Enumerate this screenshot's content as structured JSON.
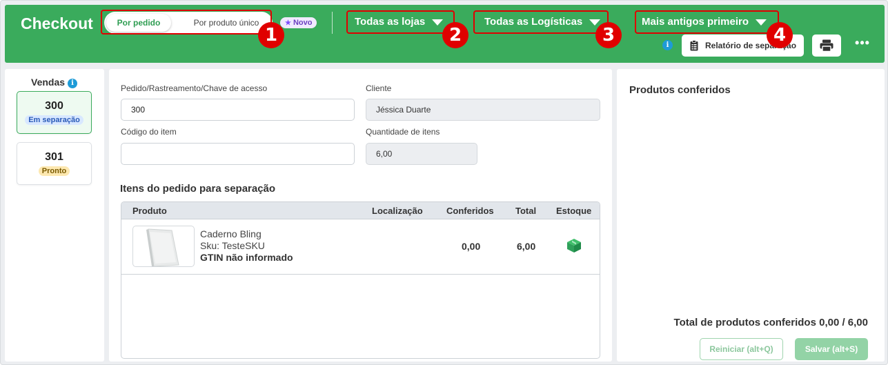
{
  "header": {
    "title": "Checkout",
    "mode_toggle": {
      "active": "Por pedido",
      "inactive": "Por produto único"
    },
    "badge_new": "Novo",
    "stores_dropdown": "Todas as lojas",
    "logistics_dropdown": "Todas as Logísticas",
    "sort_dropdown": "Mais antigos primeiro",
    "report_button": "Relatório de separação",
    "more_button": "•••"
  },
  "annotations": [
    "1",
    "2",
    "3",
    "4"
  ],
  "sidebar": {
    "title": "Vendas",
    "orders": [
      {
        "number": "300",
        "status": "Em separação",
        "selected": true
      },
      {
        "number": "301",
        "status": "Pronto",
        "selected": false
      }
    ]
  },
  "form": {
    "order_label": "Pedido/Rastreamento/Chave de acesso",
    "order_value": "300",
    "client_label": "Cliente",
    "client_value": "Jéssica Duarte",
    "item_code_label": "Código do item",
    "item_code_value": "",
    "qty_label": "Quantidade de itens",
    "qty_value": "6,00"
  },
  "items": {
    "title": "Itens do pedido para separação",
    "columns": [
      "Produto",
      "Localização",
      "Conferidos",
      "Total",
      "Estoque"
    ],
    "rows": [
      {
        "name": "Caderno Bling",
        "sku": "Sku: TesteSKU",
        "gtin": "GTIN não informado",
        "location": "",
        "checked": "0,00",
        "total": "6,00",
        "stock_icon": "box-icon"
      }
    ]
  },
  "checked_panel": {
    "title": "Produtos conferidos",
    "total_label": "Total de produtos conferidos 0,00 / 6,00",
    "reset_button": "Reiniciar (alt+Q)",
    "save_button": "Salvar (alt+S)"
  },
  "colors": {
    "header_green": "#3aab5c",
    "annotation_red": "#e00000",
    "info_blue": "#1e9bd7",
    "stock_green": "#2fa05a"
  }
}
